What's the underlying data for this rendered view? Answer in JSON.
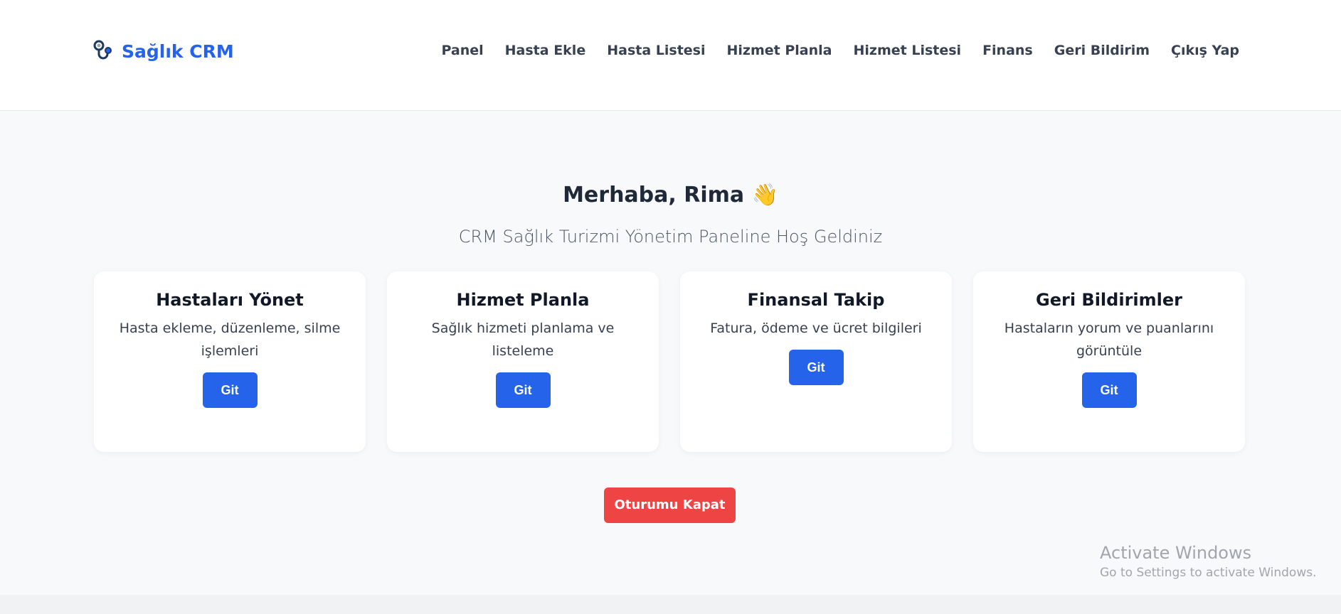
{
  "brand": {
    "name": "Sağlık CRM",
    "icon": "stethoscope-icon",
    "color": "#2563eb"
  },
  "nav": [
    {
      "label": "Panel"
    },
    {
      "label": "Hasta Ekle"
    },
    {
      "label": "Hasta Listesi"
    },
    {
      "label": "Hizmet Planla"
    },
    {
      "label": "Hizmet Listesi"
    },
    {
      "label": "Finans"
    },
    {
      "label": "Geri Bildirim"
    },
    {
      "label": "Çıkış Yap"
    }
  ],
  "main": {
    "greeting": "Merhaba, Rima 👋",
    "subtitle": "CRM Sağlık Turizmi Yönetim Paneline Hoş Geldiniz"
  },
  "cards": [
    {
      "title": "Hastaları Yönet",
      "description": "Hasta ekleme, düzenleme, silme işlemleri",
      "button": "Git"
    },
    {
      "title": "Hizmet Planla",
      "description": "Sağlık hizmeti planlama ve listeleme",
      "button": "Git"
    },
    {
      "title": "Finansal Takip",
      "description": "Fatura, ödeme ve ücret bilgileri",
      "button": "Git"
    },
    {
      "title": "Geri Bildirimler",
      "description": "Hastaların yorum ve puanlarını görüntüle",
      "button": "Git"
    }
  ],
  "logout_button": "Oturumu Kapat",
  "watermark": {
    "title": "Activate Windows",
    "subtitle": "Go to Settings to activate Windows."
  },
  "colors": {
    "primary": "#2563eb",
    "danger": "#ef4444",
    "background": "#f8f9fb"
  }
}
